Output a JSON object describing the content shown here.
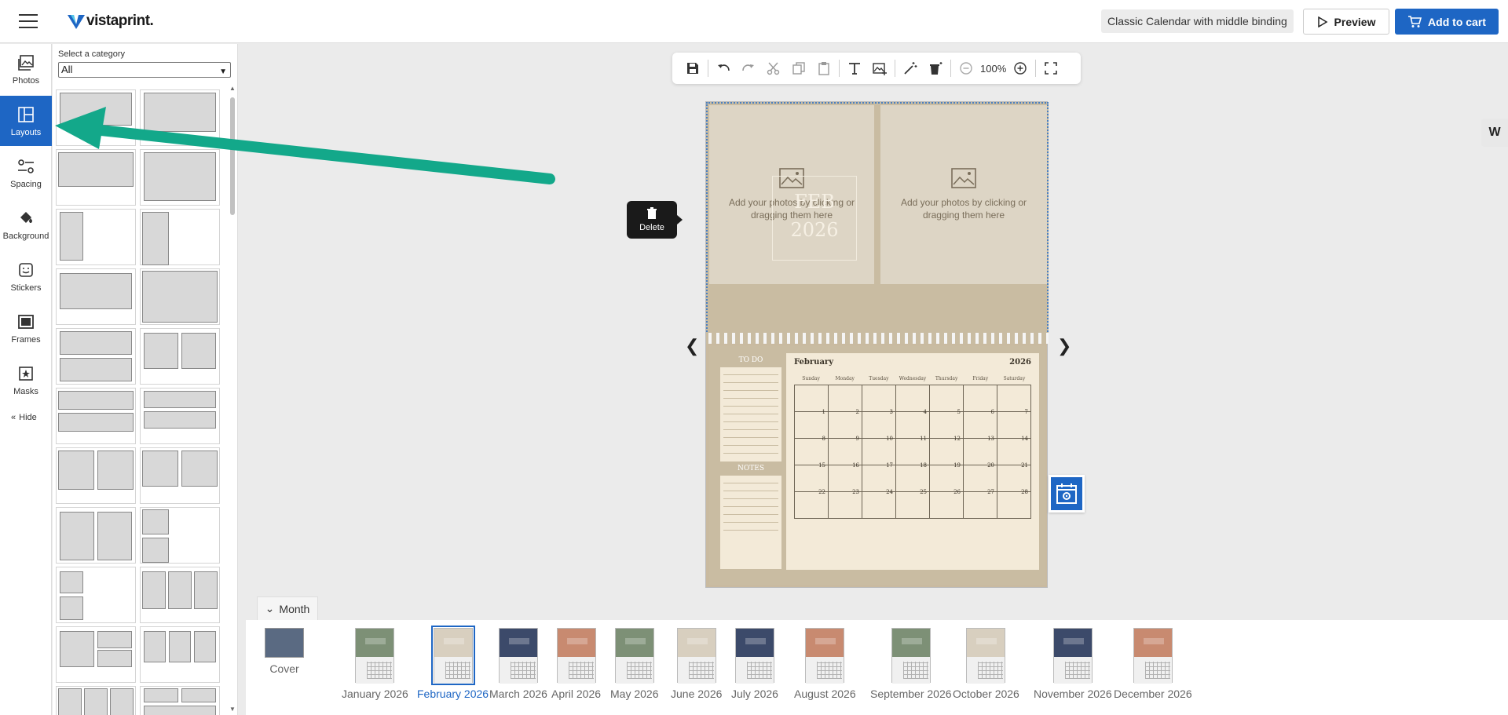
{
  "header": {
    "logo_text": "vistaprint.",
    "product_name": "Classic Calendar with middle binding",
    "preview_label": "Preview",
    "cart_label": "Add to cart",
    "accent_color": "#1e66c4"
  },
  "rail": {
    "items": [
      {
        "label": "Photos",
        "icon": "photos-icon"
      },
      {
        "label": "Layouts",
        "icon": "layouts-icon",
        "active": true
      },
      {
        "label": "Spacing",
        "icon": "spacing-icon"
      },
      {
        "label": "Background",
        "icon": "paint-bucket-icon"
      },
      {
        "label": "Stickers",
        "icon": "sticker-icon"
      },
      {
        "label": "Frames",
        "icon": "frame-icon"
      },
      {
        "label": "Masks",
        "icon": "mask-icon"
      }
    ],
    "hide_label": "Hide"
  },
  "panel": {
    "category_label": "Select a category",
    "category_value": "All"
  },
  "toolbar": {
    "zoom": "100%"
  },
  "canvas": {
    "photo_placeholder": "Add your photos by clicking or dragging them here",
    "month_abbr": "FEB",
    "year": "2026",
    "delete_label": "Delete",
    "todo_label": "TO DO",
    "notes_label": "NOTES",
    "cal_month": "February",
    "cal_year": "2026",
    "weekdays": [
      "Sunday",
      "Monday",
      "Tuesday",
      "Wednesday",
      "Thursday",
      "Friday",
      "Saturday"
    ],
    "days": [
      "",
      "",
      "",
      "",
      "",
      "",
      "",
      "1",
      "2",
      "3",
      "4",
      "5",
      "6",
      "7",
      "8",
      "9",
      "10",
      "11",
      "12",
      "13",
      "14",
      "15",
      "16",
      "17",
      "18",
      "19",
      "20",
      "21",
      "22",
      "23",
      "24",
      "25",
      "26",
      "27",
      "28"
    ]
  },
  "month_strip": {
    "toggle_label": "Month",
    "items": [
      {
        "label": "Cover",
        "top": "#5a6a82",
        "cover": true
      },
      {
        "label": "January 2026",
        "top": "#7d9076"
      },
      {
        "label": "February 2026",
        "top": "#d8cfbf",
        "active": true
      },
      {
        "label": "March 2026",
        "top": "#3c4a6a"
      },
      {
        "label": "April 2026",
        "top": "#c88a70"
      },
      {
        "label": "May 2026",
        "top": "#7d9076"
      },
      {
        "label": "June 2026",
        "top": "#d8cfbf"
      },
      {
        "label": "July 2026",
        "top": "#3c4a6a"
      },
      {
        "label": "August 2026",
        "top": "#c88a70"
      },
      {
        "label": "September 2026",
        "top": "#7d9076"
      },
      {
        "label": "October 2026",
        "top": "#d8cfbf"
      },
      {
        "label": "November 2026",
        "top": "#3c4a6a"
      },
      {
        "label": "December 2026",
        "top": "#c88a70"
      }
    ]
  }
}
